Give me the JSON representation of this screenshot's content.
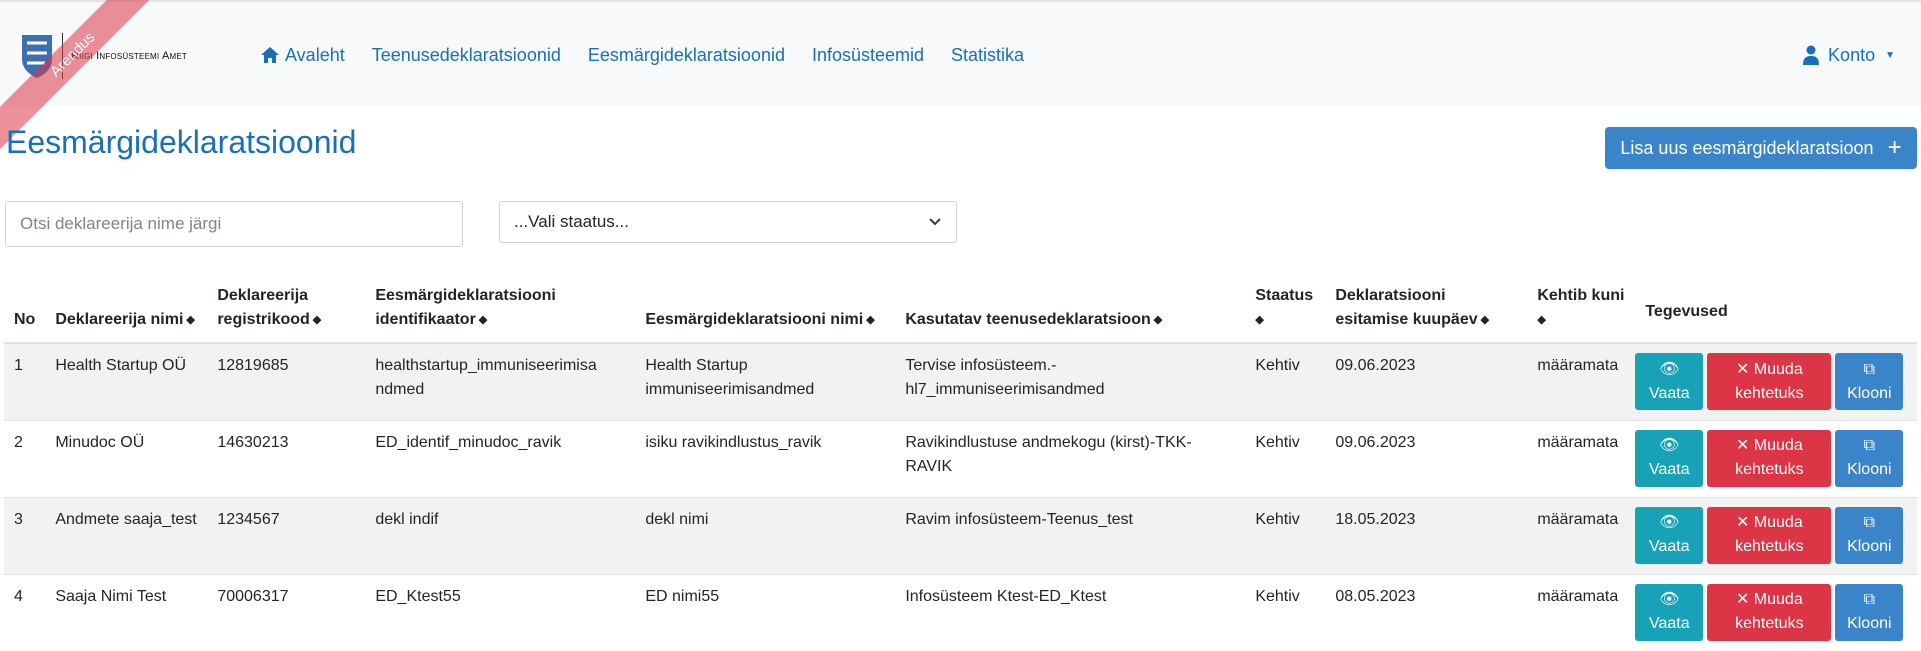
{
  "brand": {
    "name": "Riigi Infosüsteemi Amet",
    "ribbon": "Arendus"
  },
  "nav": {
    "home": "Avaleht",
    "service_declarations": "Teenusedeklaratsioonid",
    "purpose_declarations": "Eesmärgideklaratsioonid",
    "information_systems": "Infosüsteemid",
    "statistics": "Statistika",
    "account": "Konto"
  },
  "page": {
    "title": "Eesmärgideklaratsioonid",
    "add_button": "Lisa uus eesmärgideklaratsioon"
  },
  "filters": {
    "search_placeholder": "Otsi deklareerija nime järgi",
    "status_select": "...Vali staatus..."
  },
  "table": {
    "headers": {
      "no": "No",
      "declarant_name": "Deklareerija nimi",
      "declarant_reg_code_1": "Deklareerija",
      "declarant_reg_code_2": "registrikood",
      "identifier_1": "Eesmärgideklaratsiooni",
      "identifier_2": "identifikaator",
      "decl_name": "Eesmärgideklaratsiooni nimi",
      "service_decl": "Kasutatav teenusedeklaratsioon",
      "status": "Staatus",
      "submit_date_1": "Deklaratsiooni",
      "submit_date_2": "esitamise kuupäev",
      "valid_until": "Kehtib kuni",
      "actions": "Tegevused"
    },
    "buttons": {
      "view": "Vaata",
      "invalidate_1": "Muuda",
      "invalidate_2": "kehtetuks",
      "clone": "Klooni"
    },
    "rows": [
      {
        "no": "1",
        "name": "Health Startup OÜ",
        "reg": "12819685",
        "id_1": "healthstartup_immuniseerimisa",
        "id_2": "ndmed",
        "decl_1": "Health Startup",
        "decl_2": "immuniseerimisandmed",
        "svc_1": "Tervise infosüsteem.-",
        "svc_2": "hl7_immuniseerimisandmed",
        "status": "Kehtiv",
        "date": "09.06.2023",
        "valid": "määramata"
      },
      {
        "no": "2",
        "name": "Minudoc OÜ",
        "reg": "14630213",
        "id_1": "ED_identif_minudoc_ravik",
        "id_2": "",
        "decl_1": "isiku ravikindlustus_ravik",
        "decl_2": "",
        "svc_1": "Ravikindlustuse andmekogu (kirst)-TKK-",
        "svc_2": "RAVIK",
        "status": "Kehtiv",
        "date": "09.06.2023",
        "valid": "määramata"
      },
      {
        "no": "3",
        "name": "Andmete saaja_test",
        "reg": "1234567",
        "id_1": "dekl indif",
        "id_2": "",
        "decl_1": "dekl nimi",
        "decl_2": "",
        "svc_1": "Ravim infosüsteem-Teenus_test",
        "svc_2": "",
        "status": "Kehtiv",
        "date": "18.05.2023",
        "valid": "määramata"
      },
      {
        "no": "4",
        "name": "Saaja Nimi Test",
        "reg": "70006317",
        "id_1": "ED_Ktest55",
        "id_2": "",
        "decl_1": "ED nimi55",
        "decl_2": "",
        "svc_1": "Infosüsteem Ktest-ED_Ktest",
        "svc_2": "",
        "status": "Kehtiv",
        "date": "08.05.2023",
        "valid": "määramata"
      }
    ]
  },
  "colors": {
    "primary_link": "#1a6fb6",
    "button_blue": "#3a85c9",
    "button_teal": "#17a2b8",
    "button_red": "#dc3545"
  }
}
